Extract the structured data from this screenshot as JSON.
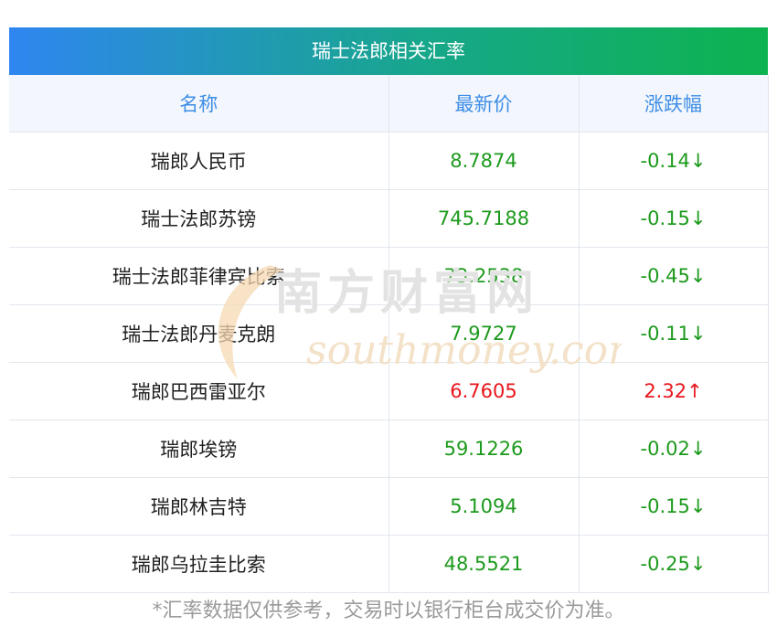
{
  "title": "瑞士法郎相关汇率",
  "headers": [
    "名称",
    "最新价",
    "涨跌幅"
  ],
  "rows": [
    {
      "name": "瑞郎人民币",
      "price": "8.7874",
      "change": "-0.14↓",
      "dir": "down"
    },
    {
      "name": "瑞士法郎苏镑",
      "price": "745.7188",
      "change": "-0.15↓",
      "dir": "down"
    },
    {
      "name": "瑞士法郎菲律宾比索",
      "price": "73.2538",
      "change": "-0.45↓",
      "dir": "down"
    },
    {
      "name": "瑞士法郎丹麦克朗",
      "price": "7.9727",
      "change": "-0.11↓",
      "dir": "down"
    },
    {
      "name": "瑞郎巴西雷亚尔",
      "price": "6.7605",
      "change": "2.32↑",
      "dir": "up"
    },
    {
      "name": "瑞郎埃镑",
      "price": "59.1226",
      "change": "-0.02↓",
      "dir": "down"
    },
    {
      "name": "瑞郎林吉特",
      "price": "5.1094",
      "change": "-0.15↓",
      "dir": "down"
    },
    {
      "name": "瑞郎乌拉圭比索",
      "price": "48.5521",
      "change": "-0.25↓",
      "dir": "down"
    }
  ],
  "watermark": {
    "cn": "南方财富网",
    "en": "southmoney.com"
  },
  "footnote": "*汇率数据仅供参考，交易时以银行柜台成交价为准。",
  "colors": {
    "down": "#1d9a1d",
    "up": "#e8161c",
    "header_text": "#3e8de6"
  }
}
